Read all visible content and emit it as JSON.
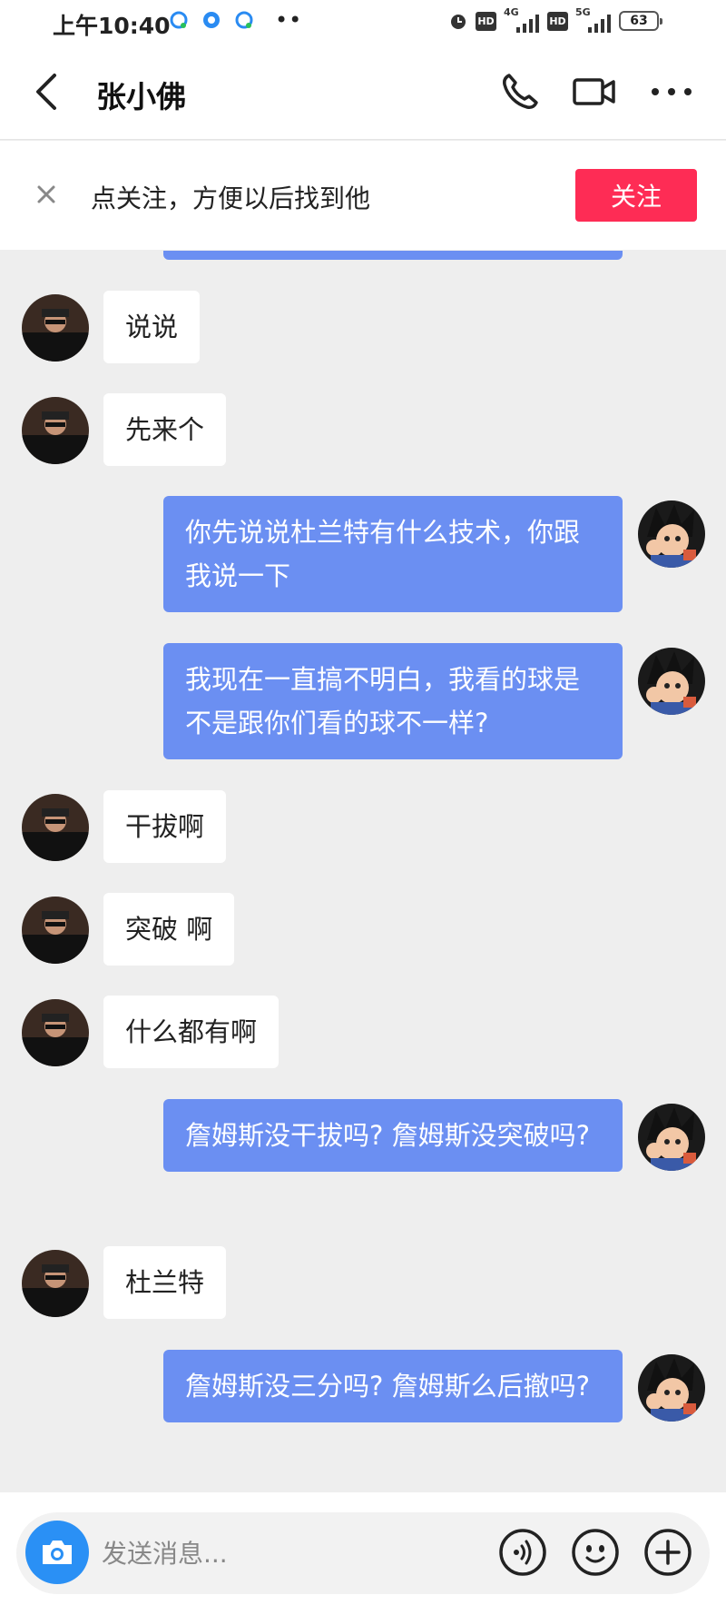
{
  "status_bar": {
    "time": "上午10:40",
    "dots": "••",
    "hd_label": "HD",
    "net1": "4G",
    "net2": "5G",
    "battery": "63"
  },
  "nav": {
    "title": "张小佛"
  },
  "banner": {
    "text": "点关注，方便以后找到他",
    "follow_label": "关注"
  },
  "messages": [
    {
      "side": "in",
      "text": "说说"
    },
    {
      "side": "in",
      "text": "先来个"
    },
    {
      "side": "out",
      "text": "你先说说杜兰特有什么技术，你跟我说一下"
    },
    {
      "side": "out",
      "text": "我现在一直搞不明白，我看的球是不是跟你们看的球不一样?"
    },
    {
      "side": "in",
      "text": "干拔啊"
    },
    {
      "side": "in",
      "text": "突破 啊"
    },
    {
      "side": "in",
      "text": "什么都有啊"
    },
    {
      "side": "out",
      "text": "詹姆斯没干拔吗? 詹姆斯没突破吗?"
    },
    {
      "side": "in",
      "text": "杜兰特"
    },
    {
      "side": "out",
      "text": "詹姆斯没三分吗? 詹姆斯么后撤吗?"
    }
  ],
  "input": {
    "placeholder": "发送消息..."
  },
  "colors": {
    "outgoing_bubble": "#6b8ff2",
    "follow_button": "#fe2c55",
    "camera_button": "#2a90f5"
  }
}
